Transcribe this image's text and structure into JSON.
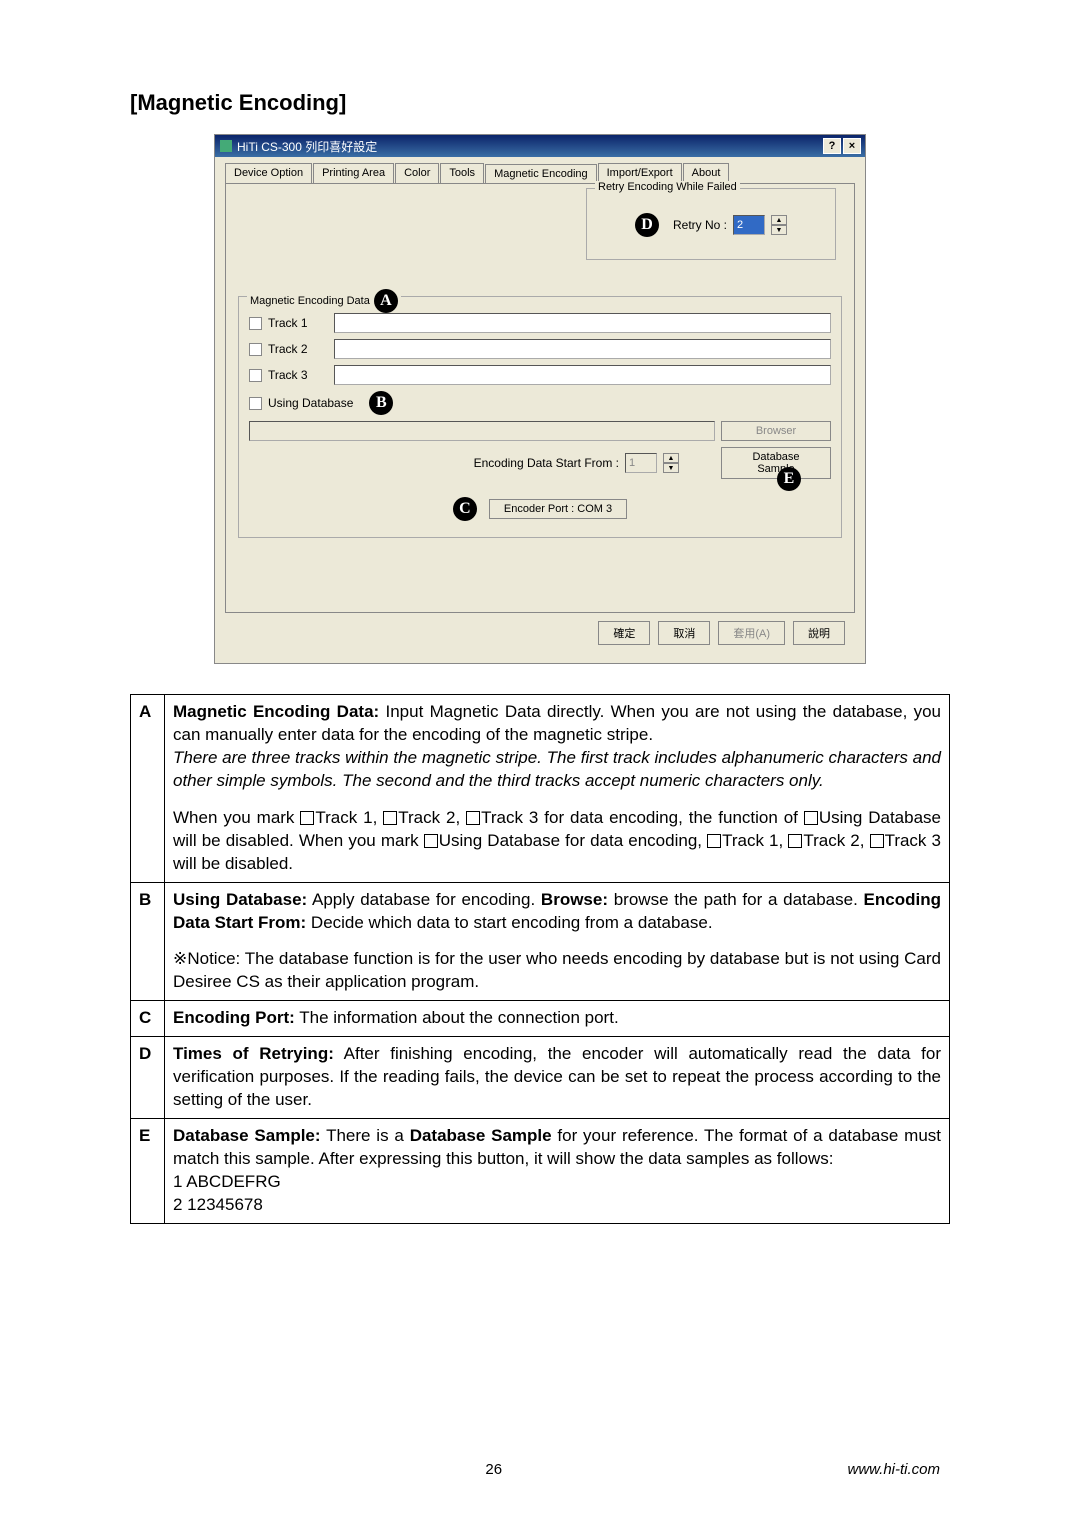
{
  "section_title": "[Magnetic Encoding]",
  "dialog": {
    "title": "HiTi CS-300 列印喜好設定",
    "help_btn": "?",
    "close_btn": "×",
    "tabs": {
      "device_option": "Device Option",
      "printing_area": "Printing Area",
      "color": "Color",
      "tools": "Tools",
      "magnetic_encoding": "Magnetic Encoding",
      "import_export": "Import/Export",
      "about": "About"
    },
    "retry_group_title": "Retry Encoding While Failed",
    "retry_label": "Retry No :",
    "retry_value": "2",
    "encoding_group_title": "Magnetic Encoding Data",
    "track1": "Track 1",
    "track2": "Track 2",
    "track3": "Track 3",
    "using_database": "Using Database",
    "browser_btn": "Browser",
    "encoding_start_label": "Encoding Data Start From :",
    "encoding_start_value": "1",
    "database_sample_btn": "Database Sample",
    "encoder_port": "Encoder Port : COM 3",
    "ok_btn": "確定",
    "cancel_btn": "取消",
    "apply_btn": "套用(A)",
    "help_btn2": "說明"
  },
  "callouts": {
    "A": "A",
    "B": "B",
    "C": "C",
    "D": "D",
    "E": "E"
  },
  "desc": {
    "A": {
      "t1": "Magnetic Encoding Data:",
      "t2": " Input Magnetic Data directly. When you are not using the database, you can manually enter data for the encoding of the magnetic stripe.",
      "t3": "There are three tracks within the magnetic stripe.   The first track includes alphanumeric characters and other simple symbols.   The second and the third tracks accept numeric characters only.",
      "t4a": "When you mark ",
      "t4b": "Track 1, ",
      "t4c": "Track 2, ",
      "t4d": "Track 3 for data encoding, the function of ",
      "t4e": "Using Database will be disabled.  When you mark ",
      "t4f": "Using Database for data encoding, ",
      "t4g": "Track 1, ",
      "t4h": "Track 2, ",
      "t4i": "Track 3 will be disabled."
    },
    "B": {
      "t1": "Using Database:",
      "t2": " Apply database for encoding. ",
      "t3": "Browse:",
      "t4": " browse the path for a database. ",
      "t5": "Encoding Data Start From:",
      "t6": " Decide which data to start encoding from a database.",
      "t7": "※Notice: The database function is for the user who needs encoding by database but is not using Card Desiree CS as their application program."
    },
    "C": {
      "t1": "Encoding Port:",
      "t2": " The information about the connection port."
    },
    "D": {
      "t1": "Times of Retrying:",
      "t2": " After finishing encoding, the encoder will automatically read the data for verification purposes.   If the reading fails, the device can be set to repeat the process according to the setting of the user."
    },
    "E": {
      "t1": "Database Sample:",
      "t2": " There is a ",
      "t3": "Database Sample",
      "t4": " for your reference. The format of a database must match this sample. After expressing this button, it will show the data samples as follows:",
      "t5": "1 ABCDEFRG",
      "t6": "2 12345678"
    }
  },
  "footer": {
    "page": "26",
    "url": "www.hi-ti.com"
  }
}
